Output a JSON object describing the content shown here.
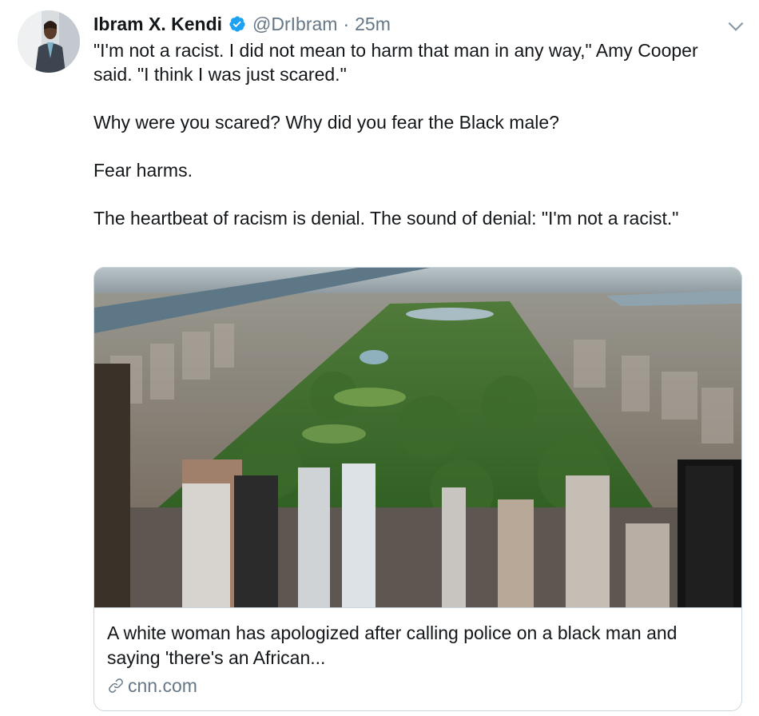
{
  "tweet": {
    "author_name": "Ibram X. Kendi",
    "handle": "@DrIbram",
    "separator": "·",
    "time": "25m",
    "paragraphs": [
      "\"I'm not a racist. I did not mean to harm that man in any way,\" Amy Cooper said. \"I think I was just scared.\"",
      "Why were you scared? Why did you fear the Black male?",
      "Fear harms.",
      "The heartbeat of racism is denial. The sound of denial: \"I'm not a racist.\""
    ]
  },
  "card": {
    "title": "A white woman has apologized after calling police on a black man and saying 'there's an African...",
    "domain": "cnn.com"
  },
  "icons": {
    "verified": "verified-badge-icon",
    "caret": "chevron-down-icon",
    "link": "link-icon"
  },
  "colors": {
    "verified_blue": "#1da1f2",
    "secondary_text": "#657786",
    "border": "#ccd6dd"
  }
}
